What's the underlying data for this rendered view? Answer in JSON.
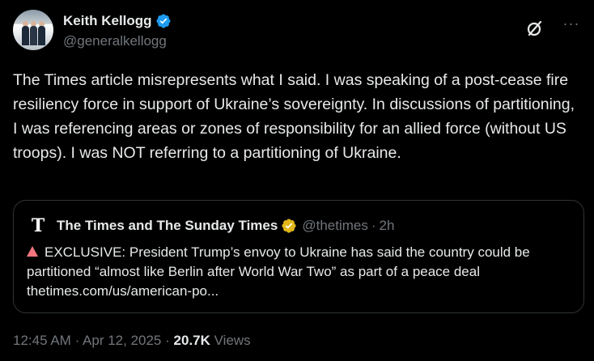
{
  "author": {
    "display_name": "Keith Kellogg",
    "handle": "@generalkellogg",
    "verified_color": "#1d9bf0"
  },
  "tweet": {
    "text": "The Times article misrepresents what I said. I was speaking of a post-cease fire resiliency force in support of Ukraine’s sovereignty. In discussions of partitioning, I was referencing areas or zones of responsibility for an allied force (without US troops). I was NOT referring to a partitioning of Ukraine."
  },
  "quoted": {
    "logo_letter": "T",
    "display_name": "The Times and The Sunday Times",
    "handle": "@thetimes",
    "separator": "·",
    "time": "2h",
    "text": "EXCLUSIVE: President Trump’s envoy to Ukraine has said the country could be partitioned “almost like Berlin after World War Two” as part of a peace deal thetimes.com/us/american-po...",
    "badge_color": "#e2b719",
    "alert_color": "#f4767e"
  },
  "meta": {
    "time": "12:45 AM",
    "sep1": "·",
    "date": "Apr 12, 2025",
    "sep2": "·",
    "views_count": "20.7K",
    "views_label": "Views"
  },
  "icons": {
    "grok": "grok-icon",
    "more": "more-icon"
  }
}
